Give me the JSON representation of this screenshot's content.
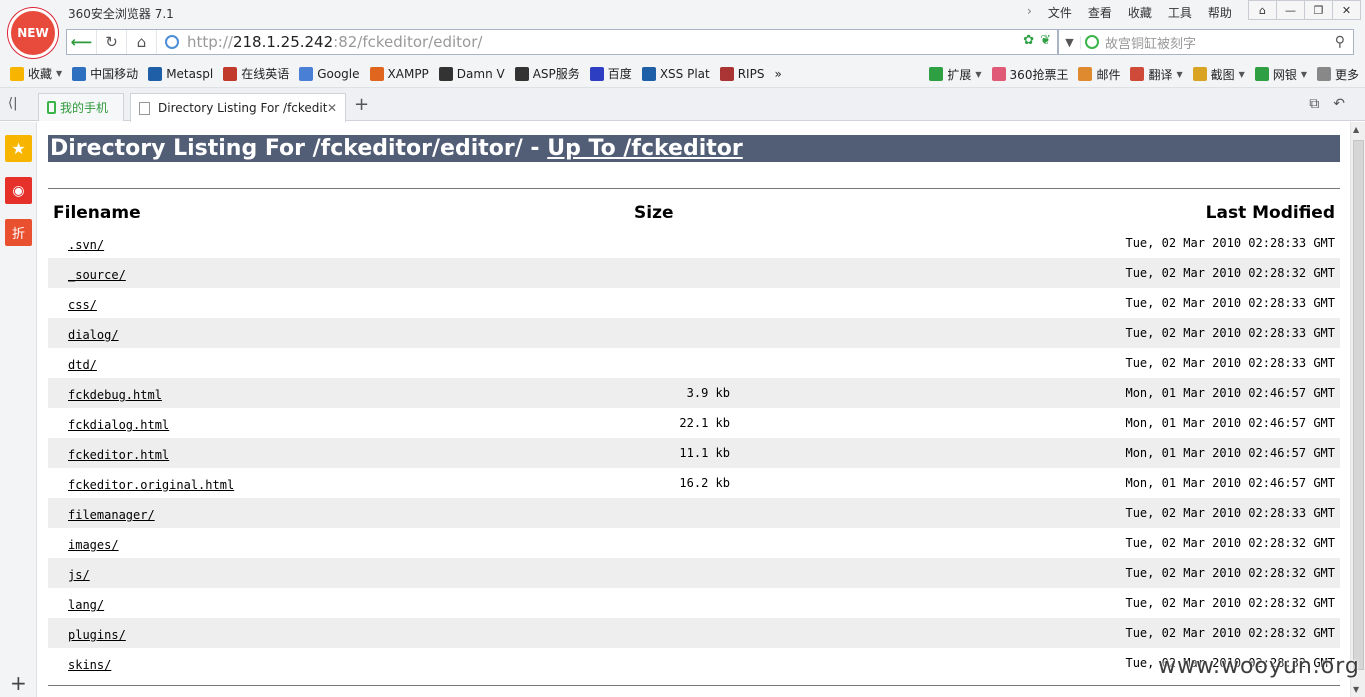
{
  "browser": {
    "title": "360安全浏览器 7.1",
    "logo_text": "NEW",
    "menus": [
      "文件",
      "查看",
      "收藏",
      "工具",
      "帮助"
    ],
    "window_buttons": [
      "⌂",
      "—",
      "❐",
      "✕"
    ]
  },
  "address": {
    "proto": "http://",
    "host": "218.1.25.242",
    "rest": ":82/fckeditor/editor/",
    "search_placeholder": "故宫铜缸被刻字"
  },
  "bookmarks": {
    "left": [
      {
        "label": "收藏",
        "icon": "star-icon",
        "color": "#f7b500",
        "dropdown": true
      },
      {
        "label": "中国移动",
        "icon": "globe-icon",
        "color": "#2f6fbf"
      },
      {
        "label": "Metaspl",
        "icon": "metasploit-icon",
        "color": "#1f5fa8"
      },
      {
        "label": "在线英语",
        "icon": "dictionary-icon",
        "color": "#c0392b"
      },
      {
        "label": "Google",
        "icon": "translate-icon",
        "color": "#4a7fd6"
      },
      {
        "label": "XAMPP",
        "icon": "xampp-icon",
        "color": "#e0651f"
      },
      {
        "label": "Damn V",
        "icon": "dvwa-icon",
        "color": "#333333"
      },
      {
        "label": "ASP服务",
        "icon": "asp-icon",
        "color": "#333333"
      },
      {
        "label": "百度",
        "icon": "baidu-icon",
        "color": "#2d3ec2"
      },
      {
        "label": "XSS Plat",
        "icon": "xss-icon",
        "color": "#1f5fa8"
      },
      {
        "label": "RIPS",
        "icon": "rips-icon",
        "color": "#a33"
      }
    ],
    "more": "»",
    "right": [
      {
        "label": "扩展",
        "icon": "grid-icon",
        "color": "#2ea043",
        "dropdown": true
      },
      {
        "label": "360抢票王",
        "icon": "ticket-icon",
        "color": "#e05a78"
      },
      {
        "label": "邮件",
        "icon": "mail-icon",
        "color": "#e08a2f"
      },
      {
        "label": "翻译",
        "icon": "translate-icon",
        "color": "#d04a3a",
        "dropdown": true
      },
      {
        "label": "截图",
        "icon": "scissors-icon",
        "color": "#d9a323",
        "dropdown": true
      },
      {
        "label": "网银",
        "icon": "bank-icon",
        "color": "#2ea043",
        "dropdown": true
      },
      {
        "label": "更多",
        "icon": "more-icon",
        "color": "#888888"
      }
    ]
  },
  "tabs": {
    "mobile_label": "我的手机",
    "active_label": "Directory Listing For /fckedit"
  },
  "page": {
    "heading_prefix": "Directory Listing For /fckeditor/editor/ - ",
    "heading_link": "Up To /fckeditor",
    "columns": [
      "Filename",
      "Size",
      "Last Modified"
    ],
    "files": [
      {
        "name": ".svn/",
        "size": "",
        "modified": "Tue, 02 Mar 2010 02:28:33 GMT"
      },
      {
        "name": "_source/",
        "size": "",
        "modified": "Tue, 02 Mar 2010 02:28:32 GMT"
      },
      {
        "name": "css/",
        "size": "",
        "modified": "Tue, 02 Mar 2010 02:28:33 GMT"
      },
      {
        "name": "dialog/",
        "size": "",
        "modified": "Tue, 02 Mar 2010 02:28:33 GMT"
      },
      {
        "name": "dtd/",
        "size": "",
        "modified": "Tue, 02 Mar 2010 02:28:33 GMT"
      },
      {
        "name": "fckdebug.html",
        "size": "3.9 kb",
        "modified": "Mon, 01 Mar 2010 02:46:57 GMT"
      },
      {
        "name": "fckdialog.html",
        "size": "22.1 kb",
        "modified": "Mon, 01 Mar 2010 02:46:57 GMT"
      },
      {
        "name": "fckeditor.html",
        "size": "11.1 kb",
        "modified": "Mon, 01 Mar 2010 02:46:57 GMT"
      },
      {
        "name": "fckeditor.original.html",
        "size": "16.2 kb",
        "modified": "Mon, 01 Mar 2010 02:46:57 GMT"
      },
      {
        "name": "filemanager/",
        "size": "",
        "modified": "Tue, 02 Mar 2010 02:28:33 GMT"
      },
      {
        "name": "images/",
        "size": "",
        "modified": "Tue, 02 Mar 2010 02:28:32 GMT"
      },
      {
        "name": "js/",
        "size": "",
        "modified": "Tue, 02 Mar 2010 02:28:32 GMT"
      },
      {
        "name": "lang/",
        "size": "",
        "modified": "Tue, 02 Mar 2010 02:28:32 GMT"
      },
      {
        "name": "plugins/",
        "size": "",
        "modified": "Tue, 02 Mar 2010 02:28:32 GMT"
      },
      {
        "name": "skins/",
        "size": "",
        "modified": "Tue, 02 Mar 2010 02:28:32 GMT"
      }
    ]
  },
  "sidebar": {
    "zhe_label": "折"
  },
  "watermark": "www.wooyun.org"
}
